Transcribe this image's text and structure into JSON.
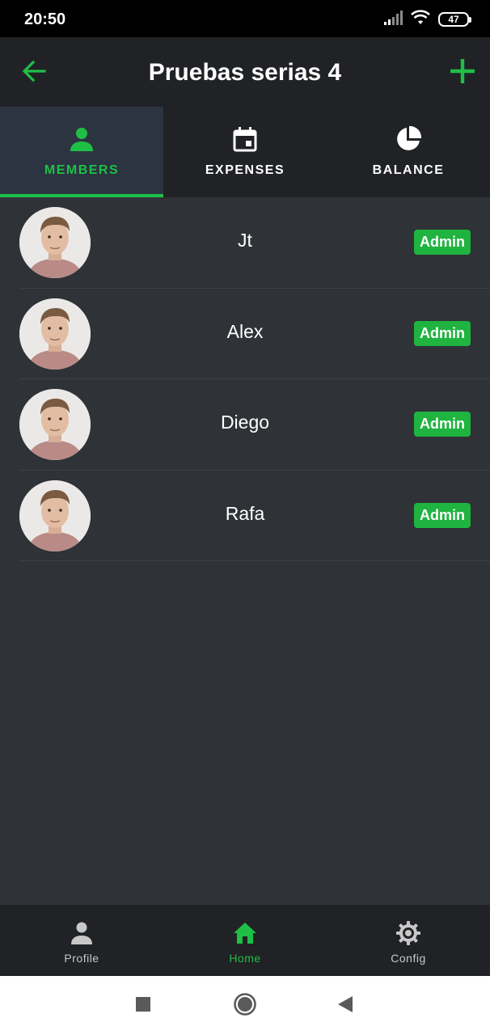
{
  "status_bar": {
    "time": "20:50",
    "battery": "47"
  },
  "app_bar": {
    "title": "Pruebas serias 4"
  },
  "tabs": [
    {
      "label": "MEMBERS",
      "icon": "person-icon",
      "active": true
    },
    {
      "label": "EXPENSES",
      "icon": "calendar-icon",
      "active": false
    },
    {
      "label": "BALANCE",
      "icon": "pie-chart-icon",
      "active": false
    }
  ],
  "members": [
    {
      "name": "Jt",
      "role": "Admin"
    },
    {
      "name": "Alex",
      "role": "Admin"
    },
    {
      "name": "Diego",
      "role": "Admin"
    },
    {
      "name": "Rafa",
      "role": "Admin"
    }
  ],
  "bottom_nav": [
    {
      "label": "Profile",
      "icon": "person-icon",
      "active": false
    },
    {
      "label": "Home",
      "icon": "home-icon",
      "active": true
    },
    {
      "label": "Config",
      "icon": "gear-icon",
      "active": false
    }
  ],
  "colors": {
    "accent": "#1fbf46",
    "background": "#2f3237",
    "surface": "#202225",
    "active_tab": "#2c3441"
  }
}
